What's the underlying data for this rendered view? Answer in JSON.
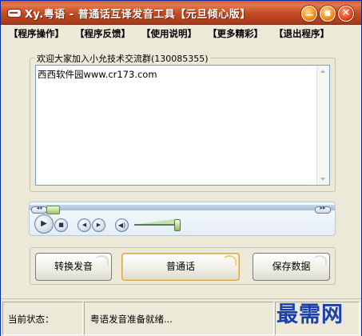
{
  "window": {
    "title": "Xy.粤语 - 普通话互译发音工具【元旦倾心版】",
    "controls": {
      "minimize_icon": "minimize-icon",
      "maximize_icon": "maximize-icon",
      "close_icon": "close-icon"
    }
  },
  "menu": {
    "items": [
      {
        "label": "【程序操作】"
      },
      {
        "label": "【程序反馈】"
      },
      {
        "label": "【使用说明】"
      },
      {
        "label": "【更多精彩】"
      },
      {
        "label": "【退出程序】"
      }
    ]
  },
  "text_group": {
    "caption": "欢迎大家加入小允技术交流群(130085355)",
    "textarea_value": "西西软件园www.cr173.com"
  },
  "player": {
    "icons": [
      "play-icon",
      "stop-icon",
      "previous-icon",
      "next-icon",
      "volume-icon"
    ],
    "volume_level": 0.95
  },
  "actions": {
    "convert_label": "转换发音",
    "mandarin_label": "普通话",
    "save_label": "保存数据"
  },
  "status": {
    "label": "当前状态：",
    "message": "粤语发音准备就绪...",
    "watermark": "最需网"
  },
  "colors": {
    "titlebar": "#c24a22",
    "window_bg": "#ece9d8",
    "watermark": "#1c40a8"
  }
}
